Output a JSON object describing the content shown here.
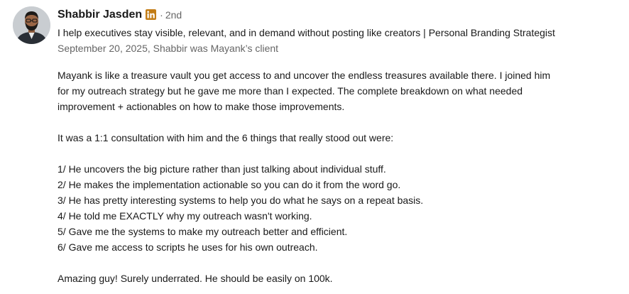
{
  "recommendation": {
    "author": {
      "name": "Shabbir Jasden",
      "linkedin_badge": "linkedin-icon",
      "separator": "·",
      "degree": "2nd",
      "headline": "I help executives stay visible, relevant, and in demand without posting like creators | Personal Branding Strategist",
      "relationship": "September 20, 2025, Shabbir was Mayank’s client"
    },
    "text": {
      "para1": "Mayank is like a treasure vault you get access to and uncover the endless treasures available there. I joined him\nfor my outreach strategy but he gave me more than I expected. The complete breakdown on what needed\nimprovement + actionables on how to make those improvements.",
      "para2": "It was a 1:1 consultation with him and the 6 things that really stood out were:",
      "points": [
        "1/ He uncovers the big picture rather than just talking about individual stuff.",
        "2/ He makes the implementation actionable so you can do it from the word go.",
        "3/ He has pretty interesting systems to help you do what he says on a repeat basis.",
        "4/ He told me EXACTLY why my outreach wasn't working.",
        "5/ Gave me the systems to make my outreach better and efficient.",
        "6/ Gave me access to scripts he uses for his own outreach."
      ],
      "closing": "Amazing guy! Surely underrated. He should be easily on 100k."
    }
  },
  "colors": {
    "text_primary": "#191919",
    "text_secondary": "#666666",
    "linkedin_badge": "#C37D16"
  }
}
